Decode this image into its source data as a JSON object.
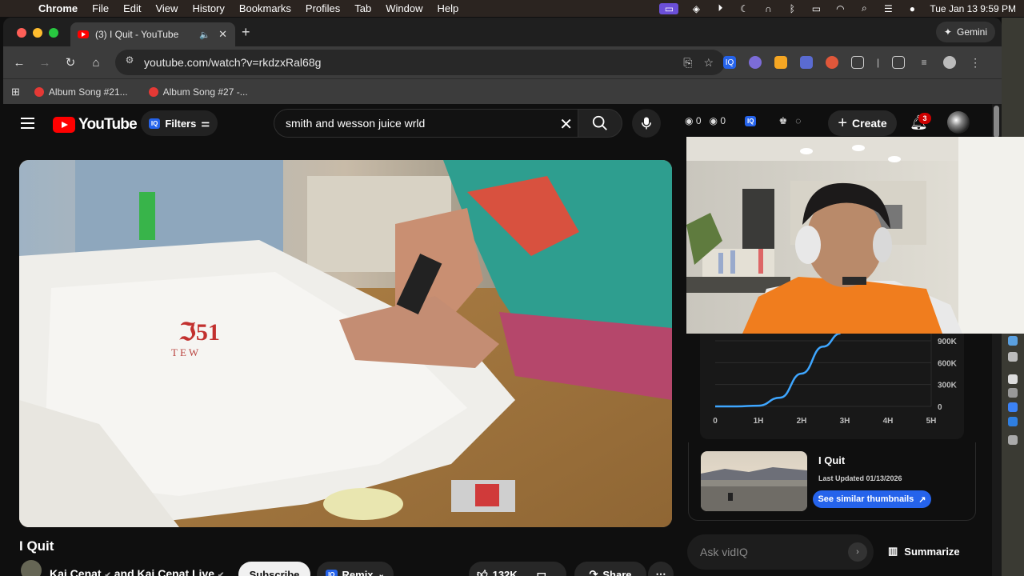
{
  "menubar": {
    "app": "Chrome",
    "items": [
      "File",
      "Edit",
      "View",
      "History",
      "Bookmarks",
      "Profiles",
      "Tab",
      "Window",
      "Help"
    ],
    "clock": "Tue Jan 13  9:59 PM"
  },
  "browser": {
    "tab_title": "(3) I Quit - YouTube",
    "gemini_label": "Gemini",
    "url": "youtube.com/watch?v=rkdzxRal68g",
    "bookmarks": [
      "Album Song #21...",
      "Album Song #27 -..."
    ]
  },
  "youtube": {
    "logo_text": "YouTube",
    "filters_label": "Filters",
    "iq_label": "IQ",
    "search_value": "smith and wesson juice wrld",
    "views_counter_a": "0",
    "views_counter_b": "0",
    "create_label": "Create",
    "notifications_count": "3"
  },
  "video": {
    "title": "I Quit",
    "channel": "Kai Cenat",
    "channel_joiner": "and",
    "channel_2": "Kai Cenat Live",
    "subscribe_label": "Subscribe",
    "remix_label": "Remix",
    "likes": "132K",
    "share_label": "Share"
  },
  "vidiq": {
    "chart_data": {
      "type": "line",
      "x_tick_labels": [
        "0",
        "1H",
        "2H",
        "3H",
        "4H",
        "5H"
      ],
      "y_tick_labels": [
        "0",
        "300K",
        "600K",
        "900K"
      ],
      "x_hours": [
        0,
        0.5,
        1.0,
        1.5,
        2.0,
        2.5,
        2.9
      ],
      "y_views": [
        0,
        0,
        10000,
        120000,
        450000,
        820000,
        1000000
      ],
      "color": "#3ea6ff"
    },
    "card_title": "I Quit",
    "last_updated": "Last Updated 01/13/2026",
    "similar_btn": "See similar thumbnails",
    "ask_placeholder": "Ask vidIQ",
    "summarize_label": "Summarize"
  },
  "colors": {
    "yt_red": "#ff0000",
    "vidiq_blue": "#2563eb",
    "chart_line": "#3ea6ff"
  }
}
